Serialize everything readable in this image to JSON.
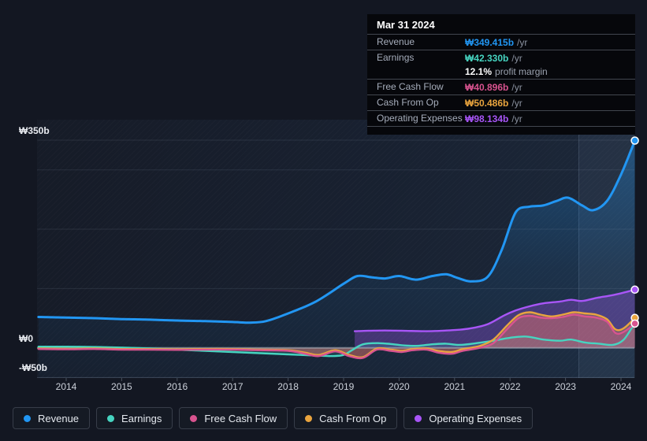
{
  "tooltip": {
    "title": "Mar 31 2024",
    "rows": [
      {
        "value": "₩349.415b",
        "suffix": "/yr"
      },
      {
        "value": "₩42.330b",
        "suffix": "/yr"
      },
      {
        "value": "₩40.896b",
        "suffix": "/yr"
      },
      {
        "value": "₩50.486b",
        "suffix": "/yr"
      },
      {
        "value": "₩98.134b",
        "suffix": "/yr"
      }
    ],
    "profit_margin": {
      "value": "12.1%",
      "label": "profit margin"
    }
  },
  "chart_data": {
    "type": "area",
    "title": "",
    "xlabel": "",
    "ylabel": "",
    "unit": "₩ billions",
    "xlim": [
      2013.45,
      2024.3
    ],
    "ylim": [
      -50,
      380
    ],
    "grid": true,
    "legend_position": "bottom",
    "x_axis": {
      "ticks": [
        2014,
        2015,
        2016,
        2017,
        2018,
        2019,
        2020,
        2021,
        2022,
        2023,
        2024
      ]
    },
    "y_axis": {
      "labeled_ticks": [
        {
          "value": 350,
          "label": "₩350b"
        },
        {
          "value": 0,
          "label": "₩0"
        },
        {
          "value": -50,
          "label": "-₩50b"
        }
      ],
      "gridlines": [
        {
          "value": 350,
          "emphasis": "minor"
        },
        {
          "value": 300,
          "emphasis": "minor"
        },
        {
          "value": 200,
          "emphasis": "minor"
        },
        {
          "value": 100,
          "emphasis": "minor"
        },
        {
          "value": 0,
          "emphasis": "zero"
        },
        {
          "value": -50,
          "emphasis": "axis"
        }
      ]
    },
    "highlight_band": {
      "x_start": 2023.23,
      "x_end": 2024.25
    },
    "draw_order": [
      0,
      4,
      1,
      3,
      2
    ],
    "series": [
      {
        "name": "Revenue",
        "color": "#2196f3",
        "stroke_width": 3,
        "fill_to": "bottom",
        "fill_opacity": 0.32,
        "points": [
          [
            2013.5,
            52
          ],
          [
            2014,
            51
          ],
          [
            2014.5,
            50
          ],
          [
            2015,
            48.5
          ],
          [
            2015.5,
            47.5
          ],
          [
            2016,
            46
          ],
          [
            2016.5,
            45
          ],
          [
            2017,
            43.5
          ],
          [
            2017.3,
            42.5
          ],
          [
            2017.6,
            45
          ],
          [
            2018,
            58
          ],
          [
            2018.5,
            78
          ],
          [
            2019,
            108
          ],
          [
            2019.25,
            121
          ],
          [
            2019.5,
            119
          ],
          [
            2019.75,
            117
          ],
          [
            2020,
            121
          ],
          [
            2020.3,
            115
          ],
          [
            2020.6,
            121
          ],
          [
            2020.85,
            124
          ],
          [
            2021.05,
            118
          ],
          [
            2021.3,
            112
          ],
          [
            2021.6,
            120
          ],
          [
            2021.85,
            165
          ],
          [
            2022.1,
            228
          ],
          [
            2022.35,
            238
          ],
          [
            2022.6,
            240
          ],
          [
            2022.85,
            248
          ],
          [
            2023.05,
            253
          ],
          [
            2023.3,
            240
          ],
          [
            2023.5,
            232
          ],
          [
            2023.75,
            248
          ],
          [
            2024,
            292
          ],
          [
            2024.25,
            349.4
          ]
        ]
      },
      {
        "name": "Earnings",
        "color": "#46d4c0",
        "stroke_width": 2.4,
        "fill_to": "zero",
        "fill_opacity": 0.16,
        "points": [
          [
            2013.5,
            2
          ],
          [
            2014,
            2
          ],
          [
            2014.5,
            1.5
          ],
          [
            2015,
            0.5
          ],
          [
            2015.5,
            -1
          ],
          [
            2016,
            -3
          ],
          [
            2016.5,
            -5
          ],
          [
            2017,
            -7
          ],
          [
            2017.5,
            -9
          ],
          [
            2018,
            -11
          ],
          [
            2018.5,
            -13
          ],
          [
            2018.8,
            -14
          ],
          [
            2019,
            -12
          ],
          [
            2019.15,
            -4
          ],
          [
            2019.35,
            6
          ],
          [
            2019.6,
            8
          ],
          [
            2019.85,
            6.5
          ],
          [
            2020.1,
            4
          ],
          [
            2020.35,
            3.5
          ],
          [
            2020.6,
            6
          ],
          [
            2020.85,
            7
          ],
          [
            2021.1,
            5
          ],
          [
            2021.4,
            8
          ],
          [
            2021.7,
            12
          ],
          [
            2022,
            17
          ],
          [
            2022.3,
            19
          ],
          [
            2022.6,
            14
          ],
          [
            2022.9,
            12
          ],
          [
            2023.1,
            14
          ],
          [
            2023.35,
            9
          ],
          [
            2023.6,
            7
          ],
          [
            2023.85,
            5
          ],
          [
            2024.05,
            14
          ],
          [
            2024.25,
            42.3
          ]
        ]
      },
      {
        "name": "Free Cash Flow",
        "color": "#d8538f",
        "stroke_width": 2.4,
        "fill_to": "zero",
        "fill_opacity": 0.3,
        "points": [
          [
            2013.5,
            -2
          ],
          [
            2014,
            -2.5
          ],
          [
            2014.5,
            -2
          ],
          [
            2015,
            -3
          ],
          [
            2015.5,
            -3
          ],
          [
            2016,
            -3.5
          ],
          [
            2016.5,
            -3
          ],
          [
            2017,
            -3
          ],
          [
            2017.5,
            -4
          ],
          [
            2018,
            -5
          ],
          [
            2018.3,
            -10
          ],
          [
            2018.55,
            -14
          ],
          [
            2018.85,
            -6
          ],
          [
            2019.1,
            -14
          ],
          [
            2019.35,
            -17
          ],
          [
            2019.6,
            -3
          ],
          [
            2019.85,
            -5
          ],
          [
            2020.05,
            -7
          ],
          [
            2020.25,
            -4
          ],
          [
            2020.5,
            -3
          ],
          [
            2020.7,
            -8
          ],
          [
            2020.95,
            -10
          ],
          [
            2021.15,
            -5
          ],
          [
            2021.45,
            0
          ],
          [
            2021.7,
            8
          ],
          [
            2021.95,
            32
          ],
          [
            2022.15,
            50
          ],
          [
            2022.35,
            54
          ],
          [
            2022.55,
            51
          ],
          [
            2022.75,
            50
          ],
          [
            2022.95,
            52
          ],
          [
            2023.15,
            56
          ],
          [
            2023.35,
            53
          ],
          [
            2023.55,
            51
          ],
          [
            2023.75,
            44
          ],
          [
            2023.9,
            25
          ],
          [
            2024.05,
            27
          ],
          [
            2024.25,
            40.9
          ]
        ]
      },
      {
        "name": "Cash From Op",
        "color": "#e9a43e",
        "stroke_width": 2.4,
        "fill_to": "zero",
        "fill_opacity": 0.28,
        "points": [
          [
            2013.5,
            -1
          ],
          [
            2014,
            -1.5
          ],
          [
            2014.5,
            -1
          ],
          [
            2015,
            -2
          ],
          [
            2015.5,
            -2
          ],
          [
            2016,
            -2.5
          ],
          [
            2016.5,
            -2
          ],
          [
            2017,
            -2
          ],
          [
            2017.5,
            -3
          ],
          [
            2018,
            -4
          ],
          [
            2018.3,
            -8
          ],
          [
            2018.55,
            -12
          ],
          [
            2018.85,
            -4
          ],
          [
            2019.1,
            -12
          ],
          [
            2019.35,
            -15.5
          ],
          [
            2019.6,
            -1
          ],
          [
            2019.85,
            -3
          ],
          [
            2020.05,
            -5
          ],
          [
            2020.25,
            -2
          ],
          [
            2020.5,
            -1
          ],
          [
            2020.7,
            -5
          ],
          [
            2020.95,
            -7
          ],
          [
            2021.15,
            -2
          ],
          [
            2021.45,
            3
          ],
          [
            2021.7,
            14
          ],
          [
            2021.95,
            38
          ],
          [
            2022.15,
            55
          ],
          [
            2022.35,
            60
          ],
          [
            2022.55,
            56
          ],
          [
            2022.75,
            53
          ],
          [
            2022.95,
            56
          ],
          [
            2023.15,
            60
          ],
          [
            2023.35,
            58
          ],
          [
            2023.55,
            56
          ],
          [
            2023.75,
            48
          ],
          [
            2023.9,
            31
          ],
          [
            2024.05,
            33
          ],
          [
            2024.25,
            50.5
          ]
        ]
      },
      {
        "name": "Operating Expenses",
        "color": "#a855f7",
        "stroke_width": 2.4,
        "fill_to": "zero",
        "fill_opacity": 0.3,
        "points": [
          [
            2019.2,
            28
          ],
          [
            2019.5,
            29
          ],
          [
            2020,
            29
          ],
          [
            2020.5,
            28
          ],
          [
            2021,
            30
          ],
          [
            2021.3,
            33
          ],
          [
            2021.6,
            40
          ],
          [
            2021.9,
            55
          ],
          [
            2022.1,
            63
          ],
          [
            2022.35,
            70
          ],
          [
            2022.6,
            75
          ],
          [
            2022.9,
            78
          ],
          [
            2023.1,
            81
          ],
          [
            2023.3,
            79
          ],
          [
            2023.55,
            84
          ],
          [
            2023.8,
            88
          ],
          [
            2024,
            92
          ],
          [
            2024.25,
            98.1
          ]
        ]
      }
    ]
  }
}
